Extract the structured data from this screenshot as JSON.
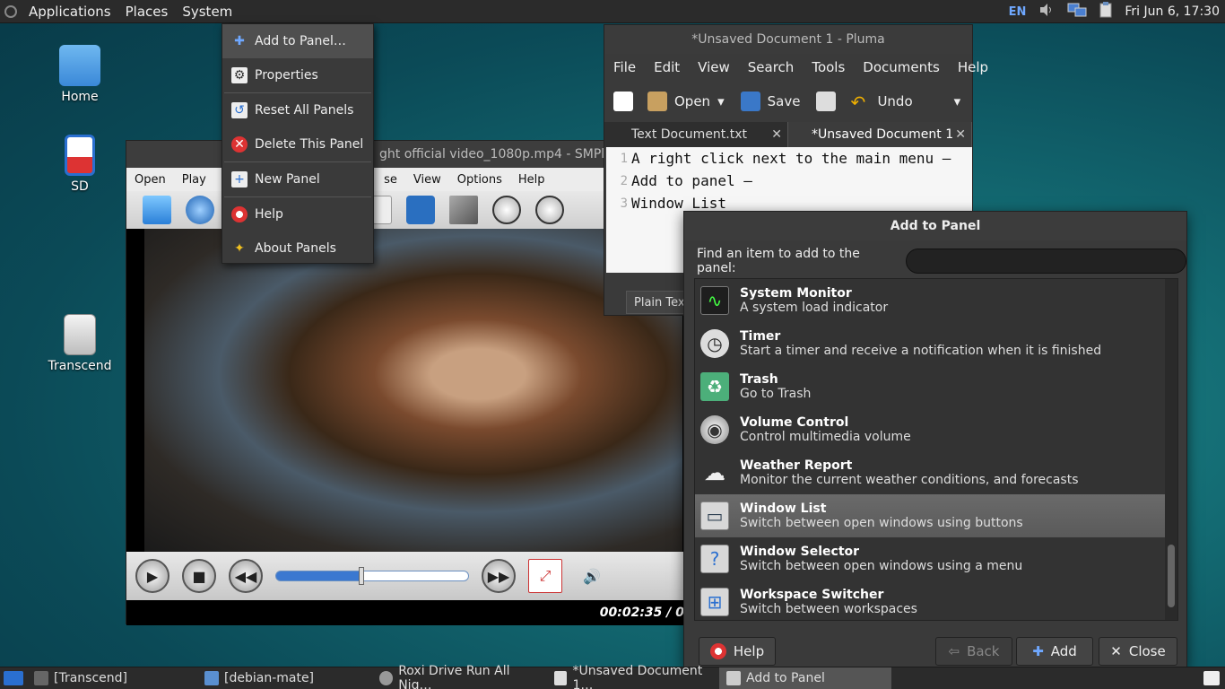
{
  "top_panel": {
    "menus": [
      "Applications",
      "Places",
      "System"
    ],
    "keyboard_layout": "EN",
    "clock": "Fri Jun  6, 17:30"
  },
  "desktop": {
    "icons": [
      {
        "label": "Home",
        "icon": "home-folder-icon"
      },
      {
        "label": "SD",
        "icon": "sd-card-icon"
      },
      {
        "label": "Transcend",
        "icon": "drive-icon"
      }
    ]
  },
  "smplayer": {
    "title": "ght official video_1080p.mp4 - SMPlay",
    "menus": [
      "Open",
      "Play",
      "Vi",
      "se",
      "View",
      "Options",
      "Help"
    ],
    "time": "00:02:35 / 0",
    "seek_fraction": 0.44
  },
  "pluma": {
    "title": "*Unsaved Document 1 - Pluma",
    "menus": [
      "File",
      "Edit",
      "View",
      "Search",
      "Tools",
      "Documents",
      "Help"
    ],
    "toolbar": {
      "open": "Open",
      "save": "Save",
      "undo": "Undo"
    },
    "tabs": [
      "Text Document.txt",
      "*Unsaved Document 1"
    ],
    "lines": [
      {
        "n": "1",
        "text": "A right click next to the main menu –"
      },
      {
        "n": "2",
        "text": "Add to panel –"
      },
      {
        "n": "3",
        "text": "Window List"
      }
    ],
    "status": "Plain Text"
  },
  "context_menu": {
    "items": [
      "Add to Panel…",
      "Properties",
      "Reset All Panels",
      "Delete This Panel",
      "New Panel",
      "Help",
      "About Panels"
    ]
  },
  "dialog": {
    "title": "Add to Panel",
    "find_label": "Find an item to add to the panel:",
    "find_value": "",
    "items": [
      {
        "name": "System Monitor",
        "desc": "A system load indicator",
        "icon": "system-monitor-icon",
        "color": "#2a2a2a"
      },
      {
        "name": "Timer",
        "desc": "Start a timer and receive a notification when it is finished",
        "icon": "timer-icon",
        "color": "#dddddd"
      },
      {
        "name": "Trash",
        "desc": "Go to Trash",
        "icon": "trash-icon",
        "color": "#4caf7a"
      },
      {
        "name": "Volume Control",
        "desc": "Control multimedia volume",
        "icon": "speaker-icon",
        "color": "#cfcfcf"
      },
      {
        "name": "Weather Report",
        "desc": "Monitor the current weather conditions, and forecasts",
        "icon": "weather-icon",
        "color": "#eeeeee"
      },
      {
        "name": "Window List",
        "desc": "Switch between open windows using buttons",
        "icon": "window-list-icon",
        "color": "#d8d8d8"
      },
      {
        "name": "Window Selector",
        "desc": "Switch between open windows using a menu",
        "icon": "window-selector-icon",
        "color": "#d8d8d8"
      },
      {
        "name": "Workspace Switcher",
        "desc": "Switch between workspaces",
        "icon": "workspace-switcher-icon",
        "color": "#d8d8d8"
      }
    ],
    "buttons": {
      "help": "Help",
      "back": "Back",
      "add": "Add",
      "close": "Close"
    }
  },
  "taskbar": {
    "tasks": [
      "[Transcend]",
      "[debian-mate]",
      "Roxi Drive Run All Nig…",
      "*Unsaved Document 1…",
      "Add to Panel"
    ]
  }
}
